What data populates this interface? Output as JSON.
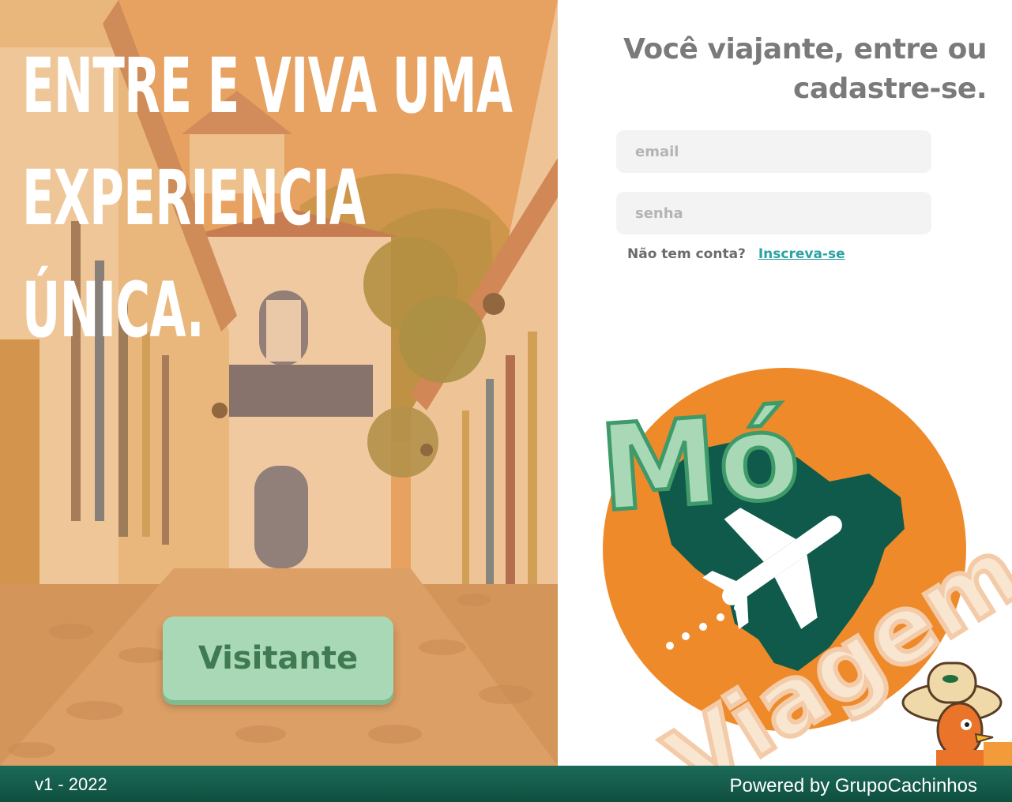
{
  "hero": {
    "headline_lines": [
      "ENTRE E VIVA UMA",
      "EXPERIENCIA",
      "ÚNICA."
    ],
    "visitor_button_label": "Visitante"
  },
  "login": {
    "title_line1": "Você viajante, entre ou",
    "title_line2": "cadastre-se.",
    "email_placeholder": "email",
    "password_placeholder": "senha",
    "no_account_text": "Não tem conta?",
    "signup_link_label": "Inscreva-se"
  },
  "logo": {
    "word1": "Mó",
    "word2": "Viagem",
    "icons": [
      "brazil-map",
      "airplane-icon",
      "rooster-mascot"
    ]
  },
  "footer": {
    "version": "v1 - 2022",
    "powered_by": "Powered by GrupoCachinhos"
  },
  "colors": {
    "brand_orange": "#ef8a2a",
    "brand_dark_green": "#0f5a4a",
    "brand_light_green": "#a8d8b5",
    "link_teal": "#2aa3a3",
    "title_gray": "#7a7a7a"
  }
}
